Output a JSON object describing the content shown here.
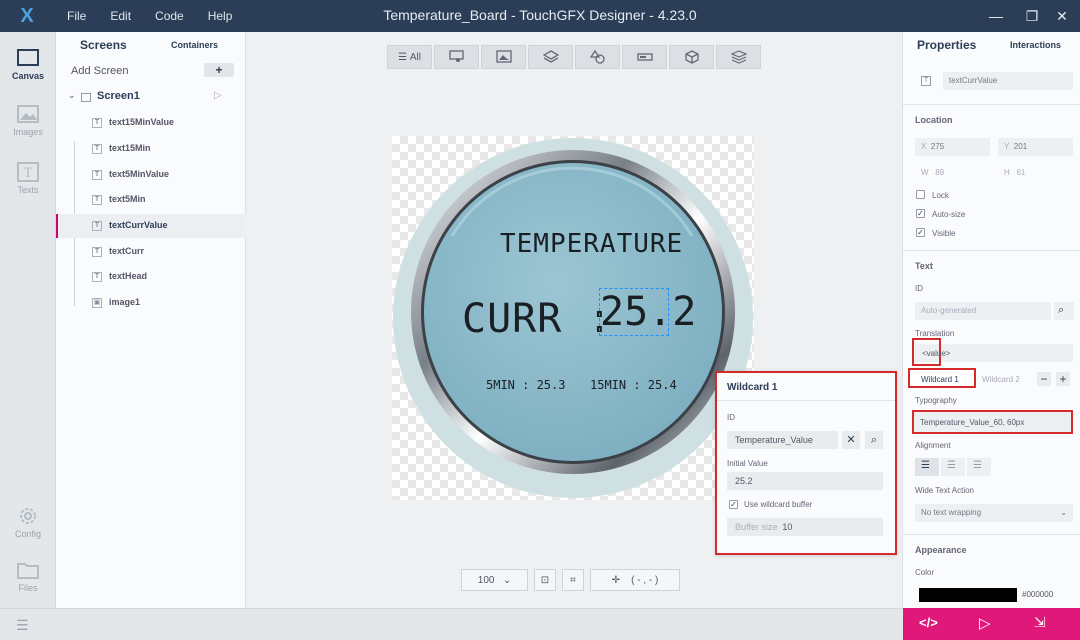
{
  "app": {
    "title": "Temperature_Board - TouchGFX Designer - 4.23.0",
    "menu": [
      "File",
      "Edit",
      "Code",
      "Help"
    ]
  },
  "rail": {
    "items": [
      {
        "label": "Canvas",
        "icon": "canvas-icon",
        "active": true
      },
      {
        "label": "Images",
        "icon": "images-icon",
        "active": false
      },
      {
        "label": "Texts",
        "icon": "texts-icon",
        "active": false
      },
      {
        "label": "Config",
        "icon": "gear-icon",
        "active": false
      },
      {
        "label": "Files",
        "icon": "folder-icon",
        "active": false
      }
    ]
  },
  "screens": {
    "tab_screens": "Screens",
    "tab_containers": "Containers",
    "add_screen": "Add Screen",
    "add_button": "+",
    "screen_name": "Screen1",
    "widgets": [
      "text15MinValue",
      "text15Min",
      "text5MinValue",
      "text5Min",
      "textCurrValue",
      "textCurr",
      "textHead",
      "image1"
    ],
    "selected": "textCurrValue"
  },
  "toolbar": {
    "filter_all": "All",
    "filter_icons": [
      "interaction-icon",
      "image-icon",
      "layers-icon",
      "shapes-icon",
      "progress-icon",
      "3d-box-icon",
      "stack-icon"
    ]
  },
  "canvas": {
    "head_text": "TEMPERATURE",
    "curr_label": "CURR :",
    "curr_value": "25.2",
    "min5": "5MIN : 25.3",
    "min15": "15MIN : 25.4"
  },
  "bottom": {
    "zoom": "100",
    "coords": "( - , - )"
  },
  "wildcard": {
    "title": "Wildcard 1",
    "id_label": "ID",
    "id_value": "Temperature_Value",
    "initial_label": "Initial Value",
    "initial_value": "25.2",
    "use_buffer_label": "Use wildcard buffer",
    "use_buffer_checked": true,
    "buffer_label": "Buffer size",
    "buffer_value": "10"
  },
  "properties": {
    "tab_properties": "Properties",
    "tab_interactions": "Interactions",
    "widget_name": "textCurrValue",
    "location_label": "Location",
    "x_label": "X",
    "x_value": "275",
    "y_label": "Y",
    "y_value": "201",
    "w_label": "W",
    "w_value": "89",
    "h_label": "H",
    "h_value": "61",
    "lock_label": "Lock",
    "autosize_label": "Auto-size",
    "visible_label": "Visible",
    "text_label": "Text",
    "id_label": "ID",
    "id_placeholder": "Auto-generated",
    "translation_label": "Translation",
    "translation_value": "<value>",
    "wildcard1": "Wildcard 1",
    "wildcard2": "Wildcard 2",
    "typography_label": "Typography",
    "typography_value": "Temperature_Value_60, 60px",
    "alignment_label": "Alignment",
    "wide_text_label": "Wide Text Action",
    "wide_text_value": "No text wrapping",
    "appearance_label": "Appearance",
    "color_label": "Color",
    "color_value": "#000000"
  },
  "colors": {
    "accent": "#d0046c",
    "highlight_border": "#d42a2a",
    "titlebar": "#2c3e57",
    "gauge_face": "#86b6c6"
  }
}
